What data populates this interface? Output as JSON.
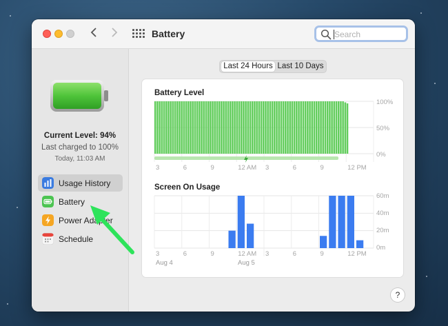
{
  "window": {
    "title": "Battery"
  },
  "search": {
    "placeholder": "Search"
  },
  "sidebar": {
    "current_level": "Current Level: 94%",
    "last_charged": "Last charged to 100%",
    "charged_time": "Today, 11:03 AM",
    "items": [
      {
        "label": "Usage History",
        "icon": "bar-chart-icon",
        "color": "#3a7be0"
      },
      {
        "label": "Battery",
        "icon": "battery-icon",
        "color": "#4cc451"
      },
      {
        "label": "Power Adapter",
        "icon": "lightning-icon",
        "color": "#f5a623"
      },
      {
        "label": "Schedule",
        "icon": "calendar-icon",
        "color": "#e8453c"
      }
    ]
  },
  "segments": [
    "Last 24 Hours",
    "Last 10 Days"
  ],
  "charts": {
    "battery_level": {
      "title": "Battery Level",
      "y_labels": [
        "100%",
        "50%",
        "0%"
      ],
      "x_labels": [
        "3",
        "6",
        "9",
        "12 AM",
        "3",
        "6",
        "9",
        "12 PM"
      ]
    },
    "screen_on": {
      "title": "Screen On Usage",
      "y_labels": [
        "60m",
        "40m",
        "20m",
        "0m"
      ],
      "x_labels": [
        "3",
        "6",
        "9",
        "12 AM",
        "3",
        "6",
        "9",
        "12 PM"
      ],
      "day_labels": [
        "Aug 4",
        "Aug 5"
      ]
    }
  },
  "chart_data": [
    {
      "type": "bar",
      "title": "Battery Level",
      "ylim": [
        0,
        100
      ],
      "x_ticks": [
        "3",
        "6",
        "9",
        "12 AM",
        "3",
        "6",
        "9",
        "12 PM"
      ],
      "values": [
        100,
        100,
        100,
        100,
        100,
        100,
        100,
        100,
        100,
        100,
        100,
        100,
        100,
        100,
        100,
        100,
        100,
        100,
        100,
        100,
        100,
        100,
        100,
        100,
        100,
        100,
        100,
        100,
        100,
        100,
        100,
        100,
        100,
        100,
        100,
        100,
        100,
        100,
        100,
        100,
        100,
        100,
        100,
        100,
        100,
        100,
        100,
        100,
        100,
        100,
        100,
        100,
        100,
        100,
        100,
        100,
        100,
        100,
        100,
        100,
        100,
        100,
        100,
        100,
        100,
        100,
        100,
        100,
        100,
        100,
        100,
        100,
        100,
        100,
        100,
        100,
        100,
        100,
        100,
        100,
        100,
        100,
        100,
        100,
        100,
        100,
        98,
        96
      ],
      "charging": true
    },
    {
      "type": "bar",
      "title": "Screen On Usage",
      "ylim": [
        0,
        60
      ],
      "ylabel": "",
      "x_ticks": [
        "3",
        "6",
        "9",
        "12 AM",
        "3",
        "6",
        "9",
        "12 PM"
      ],
      "hours": [
        0,
        0,
        0,
        0,
        0,
        0,
        0,
        0,
        20,
        60,
        28,
        0,
        0,
        0,
        0,
        0,
        0,
        0,
        14,
        60,
        60,
        60,
        9,
        0
      ],
      "grid": true
    }
  ],
  "colors": {
    "battery_green": "#62cd5c",
    "usage_blue": "#3b7cf0",
    "arrow_green": "#2ee35b"
  }
}
